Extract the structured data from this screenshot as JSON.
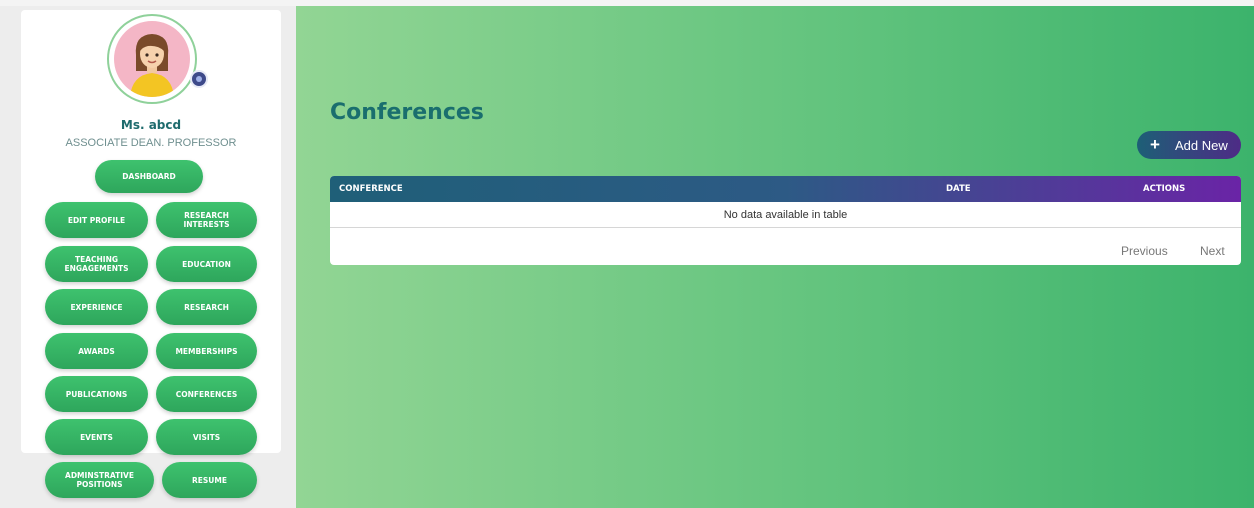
{
  "profile": {
    "name": "Ms. abcd",
    "role": "ASSOCIATE DEAN. PROFESSOR"
  },
  "nav": {
    "dashboard": "DASHBOARD",
    "edit_profile": "EDIT PROFILE",
    "research_interests": "RESEARCH INTERESTS",
    "teaching_engagements": "TEACHING ENGAGEMENTS",
    "education": "EDUCATION",
    "experience": "EXPERIENCE",
    "research": "RESEARCH",
    "awards": "AWARDS",
    "memberships": "MEMBERSHIPS",
    "publications": "PUBLICATIONS",
    "conferences": "CONFERENCES",
    "events": "EVENTS",
    "visits": "VISITS",
    "administrative_positions": "ADMINSTRATIVE POSITIONS",
    "resume": "RESUME"
  },
  "main": {
    "title": "Conferences",
    "add_button": {
      "icon": "plus-icon",
      "label": "Add New"
    },
    "table": {
      "columns": [
        "CONFERENCE",
        "DATE",
        "ACTIONS"
      ],
      "empty_message": "No data available in table"
    },
    "pagination": {
      "previous": "Previous",
      "next": "Next"
    }
  },
  "colors": {
    "nav_button": "#34b464",
    "title": "#1a6e6e",
    "header_start": "#1f5f78",
    "header_end": "#6a24a6"
  }
}
